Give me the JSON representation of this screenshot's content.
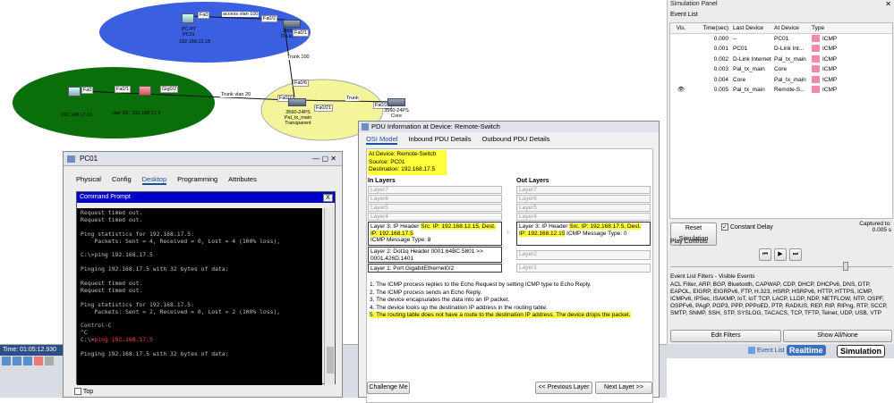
{
  "topology": {
    "pc_top": {
      "name": "PC-PT",
      "name2": "PC01",
      "ip": "192.168.12.15"
    },
    "switch_top": {
      "name": "2960",
      "name2": "D-Link"
    },
    "pc_left": {
      "ip": "192.168.17.10"
    },
    "router_left": {
      "label": "vlan 20 : 192.168.17.5"
    },
    "core_left_sw": {
      "name": "3560-24PS",
      "name2": "Pal_tx_main",
      "name3": "Transparent"
    },
    "core_sw": {
      "name": "3560-24PS",
      "name2": "Core"
    },
    "ports": {
      "p1": "Fa0",
      "p2": "Fa0/2",
      "p3": "Fa0/1",
      "p4": "Fa0/6",
      "p5": "Fa0",
      "p6": "Fa0/1",
      "p7": "Gig0/2",
      "p8": "Fa0/7",
      "p9": "Fa0/21",
      "p10": "Fa0/21"
    },
    "links": {
      "l1": "access vlan 100",
      "l2": "Trunk 100",
      "l3": "Trunk vlan 20",
      "l4": "Trunk"
    }
  },
  "statusbar": {
    "time": "Time: 01:05:12.930"
  },
  "sim_panel": {
    "title": "Simulation Panel",
    "event_list_label": "Event List",
    "columns": [
      "Vis.",
      "Time(sec)",
      "Last Device",
      "At Device",
      "Type"
    ],
    "events": [
      {
        "time": "0.000",
        "last": "--",
        "at": "PC01",
        "type": "ICMP"
      },
      {
        "time": "0.001",
        "last": "PC01",
        "at": "D-Link Int...",
        "type": "ICMP"
      },
      {
        "time": "0.002",
        "last": "D-Link Internet",
        "at": "Pal_tx_main",
        "type": "ICMP"
      },
      {
        "time": "0.003",
        "last": "Pal_tx_main",
        "at": "Core",
        "type": "ICMP"
      },
      {
        "time": "0.004",
        "last": "Core",
        "at": "Pal_tx_main",
        "type": "ICMP"
      },
      {
        "time": "0.005",
        "last": "Pal_tx_main",
        "at": "Remote-S...",
        "type": "ICMP"
      }
    ],
    "reset_label": "Reset Simulation",
    "constant_delay": "Constant Delay",
    "captured_label": "Captured to:",
    "captured_value": "0.005 s",
    "play_controls": "Play Controls",
    "filters_title": "Event List Filters - Visible Events",
    "filters_text": "ACL Filter, ARP, BGP, Bluetooth, CAPWAP, CDP, DHCP, DHCPv6, DNS, DTP, EAPOL, EIGRP, EIGRPv6, FTP, H.323, HSRP, HSRPv6, HTTP, HTTPS, ICMP, ICMPv6, IPSec, ISAKMP, IoT, IoT TCP, LACP, LLDP, NDP, NETFLOW, NTP, OSPF, OSPFv6, PAgP, POP3, PPP, PPPoED, PTP, RADIUS, REP, RIP, RIPng, RTP, SCCP, SMTP, SNMP, SSH, STP, SYSLOG, TACACS, TCP, TFTP, Telnet, UDP, USB, VTP",
    "edit_filters": "Edit Filters",
    "show_all": "Show All/None"
  },
  "bottom_tabs": {
    "event_list": "Event List",
    "realtime": "Realtime",
    "simulation": "Simulation"
  },
  "pc_window": {
    "title": "PC01",
    "tabs": [
      "Physical",
      "Config",
      "Desktop",
      "Programming",
      "Attributes"
    ],
    "cmd_title": "Command Prompt",
    "close": "X",
    "top_label": "Top",
    "lines": [
      "Request timed out.",
      "Request timed out.",
      "",
      "Ping statistics for 192.168.17.5:",
      "    Packets: Sent = 4, Received = 0, Lost = 4 (100% loss),",
      "",
      "C:\\>ping 192.168.17.5",
      "",
      "Pinging 192.168.17.5 with 32 bytes of data:",
      "",
      "Request timed out.",
      "Request timed out.",
      "",
      "Ping statistics for 192.168.17.5:",
      "    Packets: Sent = 2, Received = 0, Lost = 2 (100% loss),",
      "",
      "Control-C",
      "^C"
    ],
    "prompt": "C:\\>",
    "ping_cmd": "ping 192.168.17.5",
    "last_line": "Pinging 192.168.17.5 with 32 bytes of data:"
  },
  "pdu": {
    "title": "PDU Information at Device: Remote-Switch",
    "tabs": [
      "OSI Model",
      "Inbound PDU Details",
      "Outbound PDU Details"
    ],
    "at_device": "At Device: Remote-Switch",
    "source": "Source: PC01",
    "destination": "Destination: 192.168.17.5",
    "in_layers": "In Layers",
    "out_layers": "Out Layers",
    "empty_layers": [
      "Layer7",
      "Layer6",
      "Layer5",
      "Layer4"
    ],
    "in_l3_a": "Layer 3: IP Header ",
    "in_l3_b": "Src. IP: 192.168.12.15, Dest. IP: 192.168.17.5",
    "in_l3_c": "ICMP Message Type: 8",
    "in_l2": "Layer 2: Dot1q Header 0001.64BC.5801 >> 0001.426D.1401",
    "in_l1": "Layer 1: Port GigabitEthernet0/2",
    "out_l3_a": "Layer 3: IP Header ",
    "out_l3_b": "Src. IP: 192.168.17.5, Dest. IP: 192.168.12.15",
    "out_l3_c": " ICMP Message Type: 0",
    "out_l2": "Layer2",
    "out_l1": "Layer1",
    "steps": [
      "1. The ICMP process replies to the Echo Request by setting ICMP type to Echo Reply.",
      "2. The ICMP process sends an Echo Reply.",
      "3. The device encapsulates the data into an IP packet.",
      "4. The device looks up the destination IP address in the routing table.",
      "5. The routing table does not have a route to the destination IP address. The device drops the packet."
    ],
    "challenge": "Challenge Me",
    "prev": "<< Previous Layer",
    "next": "Next Layer >>"
  }
}
